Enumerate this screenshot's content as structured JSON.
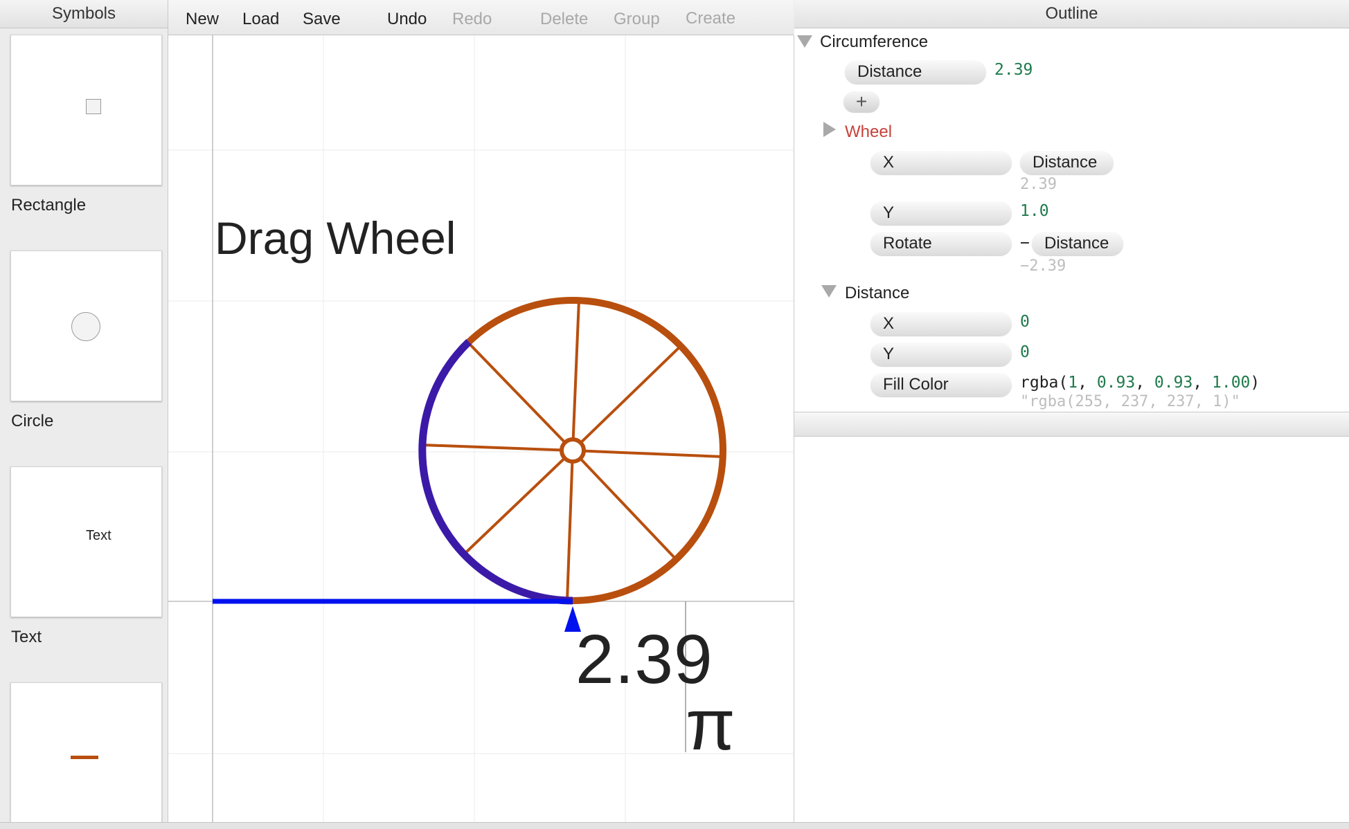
{
  "symbols": {
    "header": "Symbols",
    "items": [
      {
        "label": "Rectangle",
        "icon": "rectangle-icon"
      },
      {
        "label": "Circle",
        "icon": "circle-icon"
      },
      {
        "label": "Text",
        "icon": "text-icon",
        "preview": "Text"
      },
      {
        "label": "",
        "icon": "line-icon"
      }
    ]
  },
  "toolbar": {
    "new": "New",
    "load": "Load",
    "save": "Save",
    "undo": "Undo",
    "redo": "Redo",
    "delete": "Delete",
    "group": "Group",
    "create_symbol": "Create Symbol"
  },
  "canvas": {
    "title": "Drag Wheel",
    "readout": "2.39",
    "pi": "π"
  },
  "outline": {
    "header": "Outline",
    "root": {
      "name": "Circumference",
      "param_label": "Distance",
      "param_value": "2.39",
      "add_label": "+"
    },
    "wheel": {
      "name": "Wheel",
      "x_label": "X",
      "x_ref": "Distance",
      "x_computed": "2.39",
      "y_label": "Y",
      "y_value": "1.0",
      "rotate_label": "Rotate",
      "rotate_op": "−",
      "rotate_ref": "Distance",
      "rotate_computed": "−2.39"
    },
    "distance": {
      "name": "Distance",
      "x_label": "X",
      "x_value": "0",
      "y_label": "Y",
      "y_value": "0",
      "fill_label": "Fill Color",
      "fill_prefix": "rgba(",
      "fill_r": "1",
      "fill_g": "0.93",
      "fill_b": "0.93",
      "fill_a": "1.00",
      "fill_suffix": ")",
      "fill_string": "\"rgba(255, 237, 237, 1)\""
    }
  },
  "colors": {
    "wheel": "#b84f0e",
    "arc": "#3b1aa8",
    "distance_line": "#0010ee",
    "value_green": "#1e7a4a",
    "label_red": "#c8403a"
  }
}
